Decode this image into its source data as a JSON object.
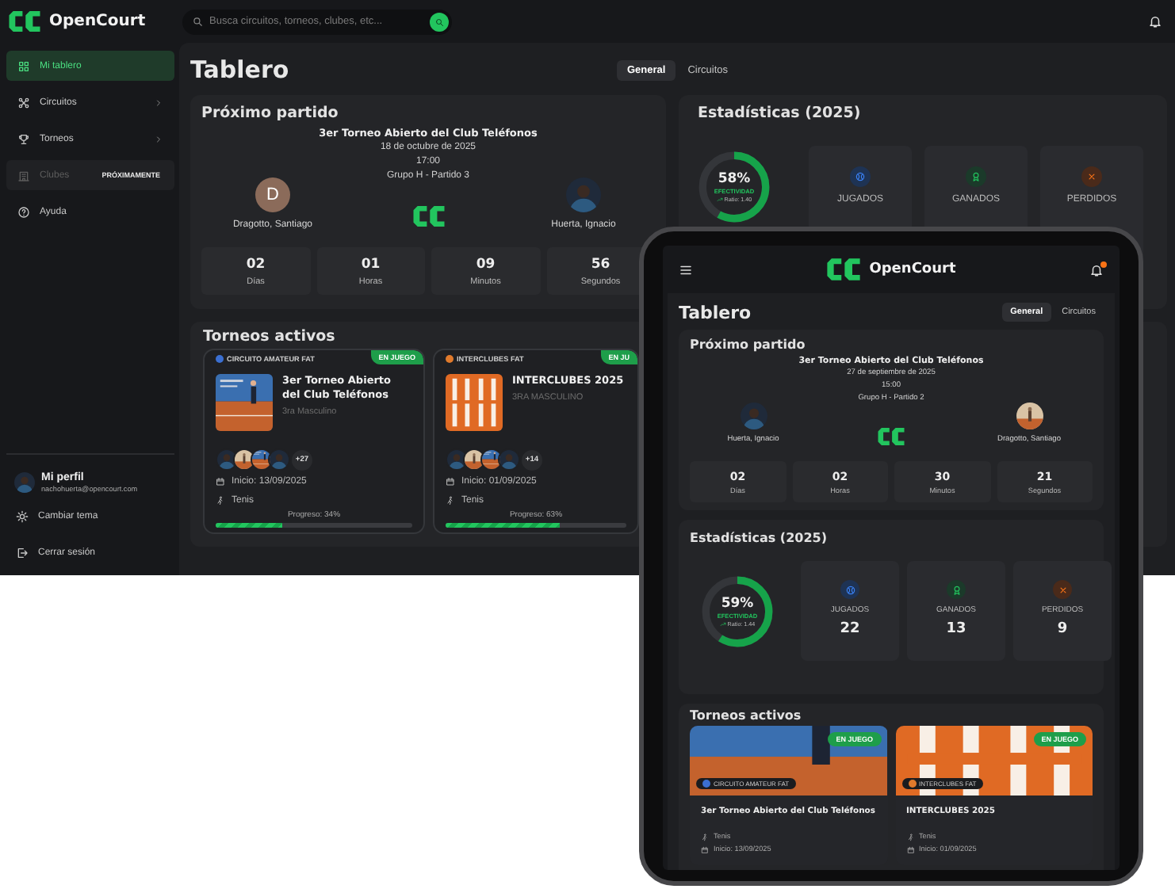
{
  "desktop": {
    "app_name": "OpenCourt",
    "search": {
      "placeholder": "Busca circuitos, torneos, clubes, etc..."
    },
    "sidebar": {
      "items": [
        {
          "label": "Mi tablero",
          "selected": true,
          "disabled": false,
          "submenu": false
        },
        {
          "label": "Circuitos",
          "selected": false,
          "disabled": false,
          "submenu": true
        },
        {
          "label": "Torneos",
          "selected": false,
          "disabled": false,
          "submenu": true
        },
        {
          "label": "Clubes",
          "selected": false,
          "disabled": true,
          "submenu": false,
          "badge": "PRÓXIMAMENTE"
        },
        {
          "label": "Ayuda",
          "selected": false,
          "disabled": false,
          "submenu": false
        }
      ]
    },
    "profile": {
      "name": "Mi perfil",
      "email": "nachohuerta@opencourt.com",
      "avatar": {
        "kind": "picture"
      }
    },
    "actions": [
      {
        "label": "Cambiar tema"
      },
      {
        "label": "Cerrar sesión"
      }
    ],
    "page_title": "Tablero",
    "tabs": [
      {
        "label": "General",
        "selected": true
      },
      {
        "label": "Circuitos",
        "selected": false
      }
    ],
    "next_match": {
      "title": "Próximo partido",
      "tournament": "3er Torneo Abierto del Club Teléfonos",
      "date": "18 de octubre de 2025",
      "time": "17:00",
      "group": "Grupo H - Partido 3",
      "players": [
        {
          "name": "Dragotto, Santiago",
          "avatar": {
            "kind": "initial",
            "text": "D"
          }
        },
        {
          "name": "Huerta, Ignacio",
          "avatar": {
            "kind": "picture"
          }
        }
      ],
      "countdown": [
        {
          "value": "02",
          "unit": "Días"
        },
        {
          "value": "01",
          "unit": "Horas"
        },
        {
          "value": "09",
          "unit": "Minutos"
        },
        {
          "value": "56",
          "unit": "Segundos"
        }
      ]
    },
    "stats": {
      "title": "Estadísticas (2025)",
      "percent": "58%",
      "label": "EFECTIVIDAD",
      "ratio": "Ratio: 1.40",
      "level": 0.58,
      "cards": [
        {
          "kind": "played",
          "label": "JUGADOS"
        },
        {
          "kind": "won",
          "label": "GANADOS"
        },
        {
          "kind": "lost",
          "label": "PERDIDOS"
        }
      ]
    },
    "active_tournaments": {
      "title": "Torneos activos",
      "cards": [
        {
          "circuit": "CIRCUITO AMATEUR FAT",
          "color": "#3b6fd1",
          "status": "EN JUEGO",
          "title": "3er Torneo Abierto del Club Teléfonos",
          "category": "3ra Masculino",
          "members": [
            {
              "kind": "picture"
            },
            {
              "kind": "picture"
            },
            {
              "kind": "picture"
            },
            {
              "kind": "picture"
            }
          ],
          "extra_count": "+27",
          "start": "Inicio: 13/09/2025",
          "sport": "Tenis",
          "progress_label": "Progreso: 34%",
          "level": 0.34
        },
        {
          "circuit": "INTERCLUBES FAT",
          "color": "#e07a2c",
          "status": "EN JU",
          "title": "INTERCLUBES 2025",
          "category": "3RA MASCULINO",
          "members": [
            {
              "kind": "picture"
            },
            {
              "kind": "picture"
            },
            {
              "kind": "picture"
            },
            {
              "kind": "picture"
            }
          ],
          "extra_count": "+14",
          "start": "Inicio: 01/09/2025",
          "sport": "Tenis",
          "progress_label": "Progreso: 63%",
          "level": 0.63
        }
      ]
    }
  },
  "tablet": {
    "app_name": "OpenCourt",
    "unread": true,
    "page_title": "Tablero",
    "tabs": [
      {
        "label": "General",
        "selected": true
      },
      {
        "label": "Circuitos",
        "selected": false
      }
    ],
    "next_match": {
      "title": "Próximo partido",
      "tournament": "3er Torneo Abierto del Club Teléfonos",
      "date": "27 de septiembre de 2025",
      "time": "15:00",
      "group": "Grupo H - Partido 2",
      "players": [
        {
          "name": "Huerta, Ignacio",
          "avatar": {
            "kind": "picture"
          }
        },
        {
          "name": "Dragotto, Santiago",
          "avatar": {
            "kind": "picture"
          }
        }
      ],
      "countdown": [
        {
          "value": "02",
          "unit": "Días"
        },
        {
          "value": "02",
          "unit": "Horas"
        },
        {
          "value": "30",
          "unit": "Minutos"
        },
        {
          "value": "21",
          "unit": "Segundos"
        }
      ]
    },
    "stats": {
      "title": "Estadísticas (2025)",
      "percent": "59%",
      "label": "EFECTIVIDAD",
      "ratio": "Ratio: 1.44",
      "level": 0.59,
      "cards": [
        {
          "kind": "played",
          "label": "JUGADOS",
          "value": "22"
        },
        {
          "kind": "won",
          "label": "GANADOS",
          "value": "13"
        },
        {
          "kind": "lost",
          "label": "PERDIDOS",
          "value": "9"
        }
      ]
    },
    "active_tournaments": {
      "title": "Torneos activos",
      "cards": [
        {
          "circuit": "CIRCUITO AMATEUR FAT",
          "color": "#3b6fd1",
          "status": "EN JUEGO",
          "title": "3er Torneo Abierto del Club Teléfonos",
          "sport": "Tenis",
          "start": "Inicio: 13/09/2025"
        },
        {
          "circuit": "INTERCLUBES FAT",
          "color": "#e07a2c",
          "status": "EN JUEGO",
          "title": "INTERCLUBES 2025",
          "sport": "Tenis",
          "start": "Inicio: 01/09/2025"
        }
      ]
    }
  }
}
